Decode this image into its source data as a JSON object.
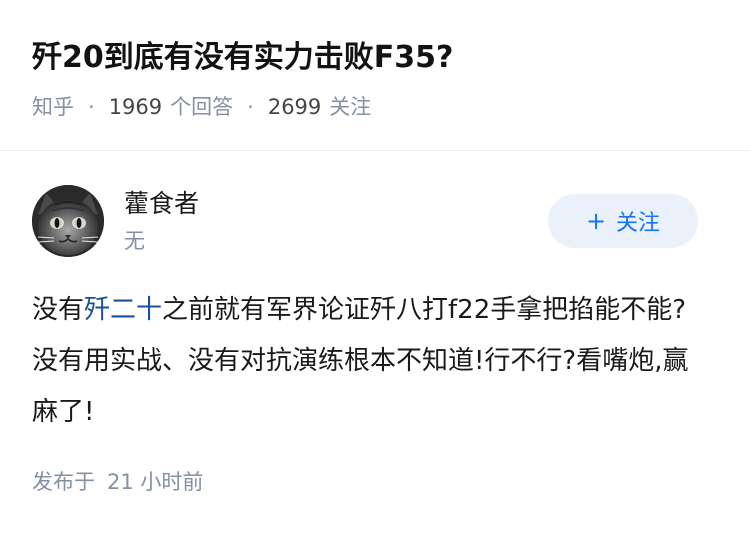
{
  "question": {
    "title": "歼20到底有没有实力击败F35?",
    "source": "知乎",
    "answer_count": "1969",
    "answer_label": "个回答",
    "follower_count": "2699",
    "follower_label": "关注",
    "separator": "·"
  },
  "answer": {
    "author": {
      "name": "藿食者",
      "headline": "无",
      "avatar_icon": "cat-avatar-icon"
    },
    "follow_button": {
      "icon": "plus-icon",
      "plus_symbol": "+",
      "label": "关注"
    },
    "content": {
      "prefix": "没有",
      "link_text": "歼二十",
      "suffix": "之前就有军界论证歼八打f22手拿把掐能不能?没有用实战、没有对抗演练根本不知道!行不行?看嘴炮,赢麻了!"
    },
    "time": {
      "label": "发布于",
      "value": "21 小时前"
    }
  },
  "colors": {
    "link": "#175199",
    "follow_bg": "#eaf1fb",
    "follow_text": "#1772f6",
    "meta": "#8590a6"
  }
}
